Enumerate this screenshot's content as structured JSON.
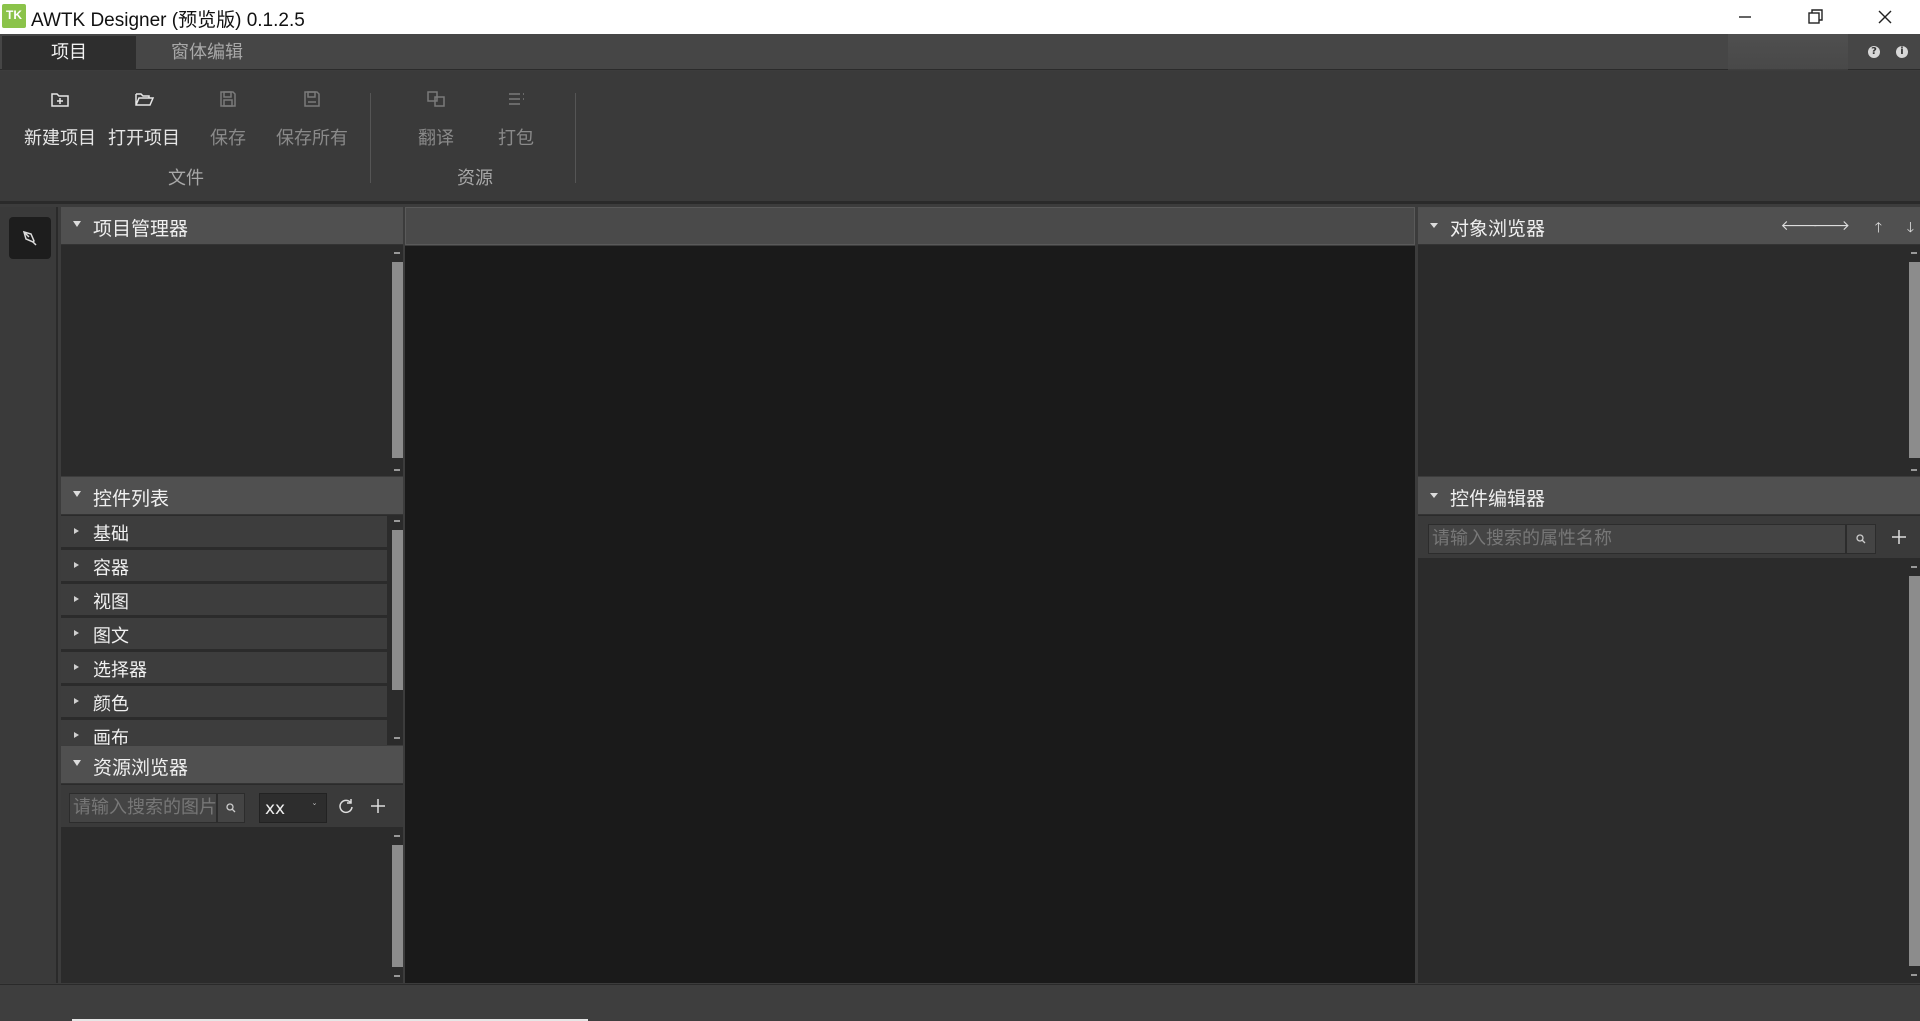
{
  "window": {
    "logo_text": "TK",
    "title": "AWTK Designer (预览版)  0.1.2.5"
  },
  "tabs": [
    {
      "label": "项目"
    },
    {
      "label": "窗体编辑"
    }
  ],
  "ribbon": {
    "file_group": {
      "label": "文件",
      "buttons": [
        {
          "label": "新建项目",
          "icon": "new-project-icon"
        },
        {
          "label": "打开项目",
          "icon": "open-folder-icon"
        },
        {
          "label": "保存",
          "icon": "save-icon"
        },
        {
          "label": "保存所有",
          "icon": "save-all-icon"
        }
      ]
    },
    "resource_group": {
      "label": "资源",
      "buttons": [
        {
          "label": "翻译",
          "icon": "translate-icon"
        },
        {
          "label": "打包",
          "icon": "package-icon"
        }
      ]
    }
  },
  "panels": {
    "project_manager": {
      "title": "项目管理器"
    },
    "control_list": {
      "title": "控件列表",
      "items": [
        "基础",
        "容器",
        "视图",
        "图文",
        "选择器",
        "颜色",
        "画布"
      ]
    },
    "resource_browser": {
      "title": "资源浏览器",
      "search_placeholder": "请输入搜索的图片",
      "filter_value": "xx"
    },
    "object_browser": {
      "title": "对象浏览器"
    },
    "control_editor": {
      "title": "控件编辑器",
      "search_placeholder": "请输入搜索的属性名称"
    }
  },
  "help_glyph": "?",
  "info_glyph": "i",
  "colors": {
    "titlebar": "#ffffff",
    "tabbar": "#464646",
    "panel_header": "#505050",
    "panel_body": "#2b2b2b",
    "canvas": "#1a1a1a",
    "logo": "#8bc34a"
  }
}
